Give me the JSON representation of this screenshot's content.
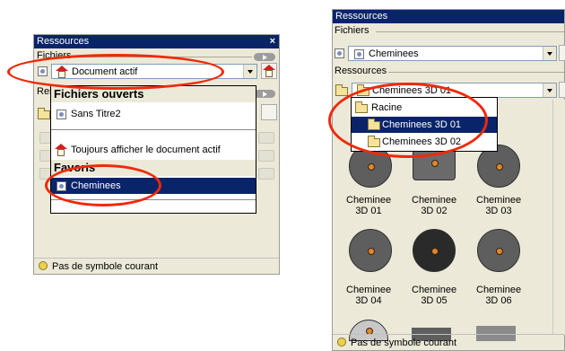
{
  "left_panel": {
    "title": "Ressources",
    "close_glyph": "×",
    "files_label": "Fichiers",
    "file_combo_value": "Document actif",
    "resources_label": "Res",
    "dropdown": {
      "open_files_header": "Fichiers ouverts",
      "items": [
        "Sans Titre2"
      ],
      "always_show": "Toujours afficher le document actif",
      "favorites_header": "Favoris",
      "favorite_selected": "Cheminees"
    },
    "status": "Pas de symbole courant"
  },
  "right_panel": {
    "title": "Ressources",
    "files_label": "Fichiers",
    "file_combo_value": "Cheminees",
    "resources_label": "Ressources",
    "resource_combo_value": "Cheminees 3D 01",
    "dropdown": {
      "items": [
        "Racine",
        "Cheminees 3D 01",
        "Cheminees 3D 02"
      ],
      "selected": "Cheminees 3D 01"
    },
    "symbols": [
      {
        "label": "Cheminee 3D 01"
      },
      {
        "label": "Cheminee 3D 02"
      },
      {
        "label": "Cheminee 3D 03"
      },
      {
        "label": "Cheminee 3D 04"
      },
      {
        "label": "Cheminee 3D 05"
      },
      {
        "label": "Cheminee 3D 06"
      }
    ],
    "status": "Pas de symbole courant"
  },
  "colors": {
    "highlight": "#0a246a",
    "annotation_oval": "#ee2a0a",
    "panel_bg": "#ece9d8"
  }
}
